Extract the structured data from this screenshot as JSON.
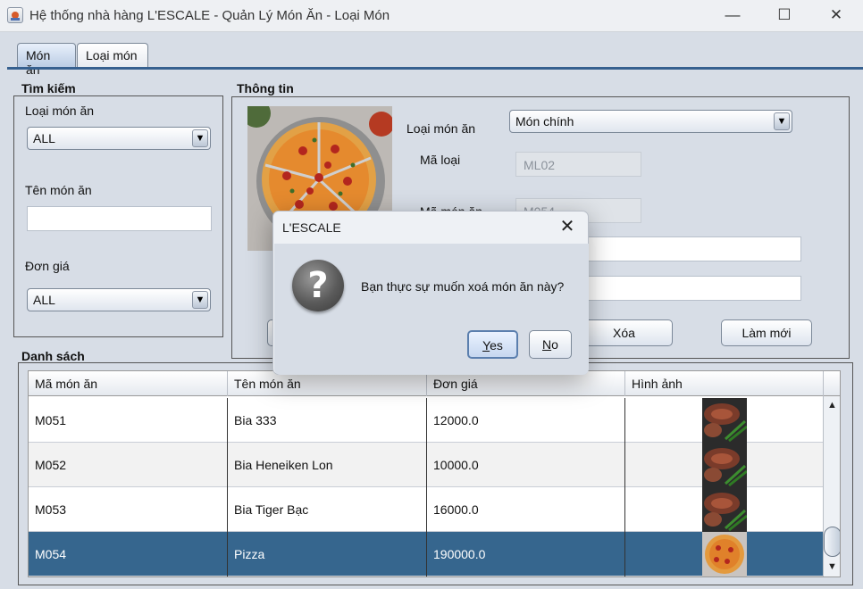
{
  "window": {
    "title": "Hệ thống nhà hàng L'ESCALE - Quản Lý Món Ăn - Loại Món",
    "minimize": "—",
    "maximize": "☐",
    "close": "✕"
  },
  "tabs": [
    {
      "label": "Món ăn"
    },
    {
      "label": "Loại món"
    }
  ],
  "search": {
    "title": "Tìm kiếm",
    "category_label": "Loại món ăn",
    "category_value": "ALL",
    "name_label": "Tên món ăn",
    "name_value": "",
    "price_label": "Đơn giá",
    "price_value": "ALL"
  },
  "info": {
    "title": "Thông tin",
    "category_label": "Loại món ăn",
    "category_value": "Món chính",
    "code_type_label": "Mã loại",
    "code_type_value": "ML02",
    "dish_code_label": "Mã món ăn",
    "dish_code_value": "M054",
    "delete_button": "Xóa",
    "refresh_button": "Làm mới"
  },
  "list": {
    "title": "Danh sách",
    "columns": [
      "Mã món ăn",
      "Tên món ăn",
      "Đơn giá",
      "Hình ảnh"
    ],
    "rows": [
      {
        "code": "M051",
        "name": "Bia 333",
        "price": "12000.0",
        "image": "steak-image"
      },
      {
        "code": "M052",
        "name": "Bia Heneiken Lon",
        "price": "10000.0",
        "image": "steak-image"
      },
      {
        "code": "M053",
        "name": "Bia Tiger Bạc",
        "price": "16000.0",
        "image": "steak-image"
      },
      {
        "code": "M054",
        "name": "Pizza",
        "price": "190000.0",
        "image": "pizza-image"
      }
    ],
    "selected_code": "M054"
  },
  "dialog": {
    "title": "L'ESCALE",
    "message": "Bạn thực sự muốn xoá món ăn này?",
    "yes_mnemonic": "Y",
    "yes_rest": "es",
    "no_mnemonic": "N",
    "no_rest": "o",
    "close": "✕",
    "icon": "question-icon"
  },
  "icons": {
    "combo_arrow": "▼",
    "scroll_up": "▲",
    "scroll_down": "▼"
  },
  "colors": {
    "selected_row": "#36668e",
    "tab_line": "#36608f",
    "background": "#d7dde6"
  }
}
